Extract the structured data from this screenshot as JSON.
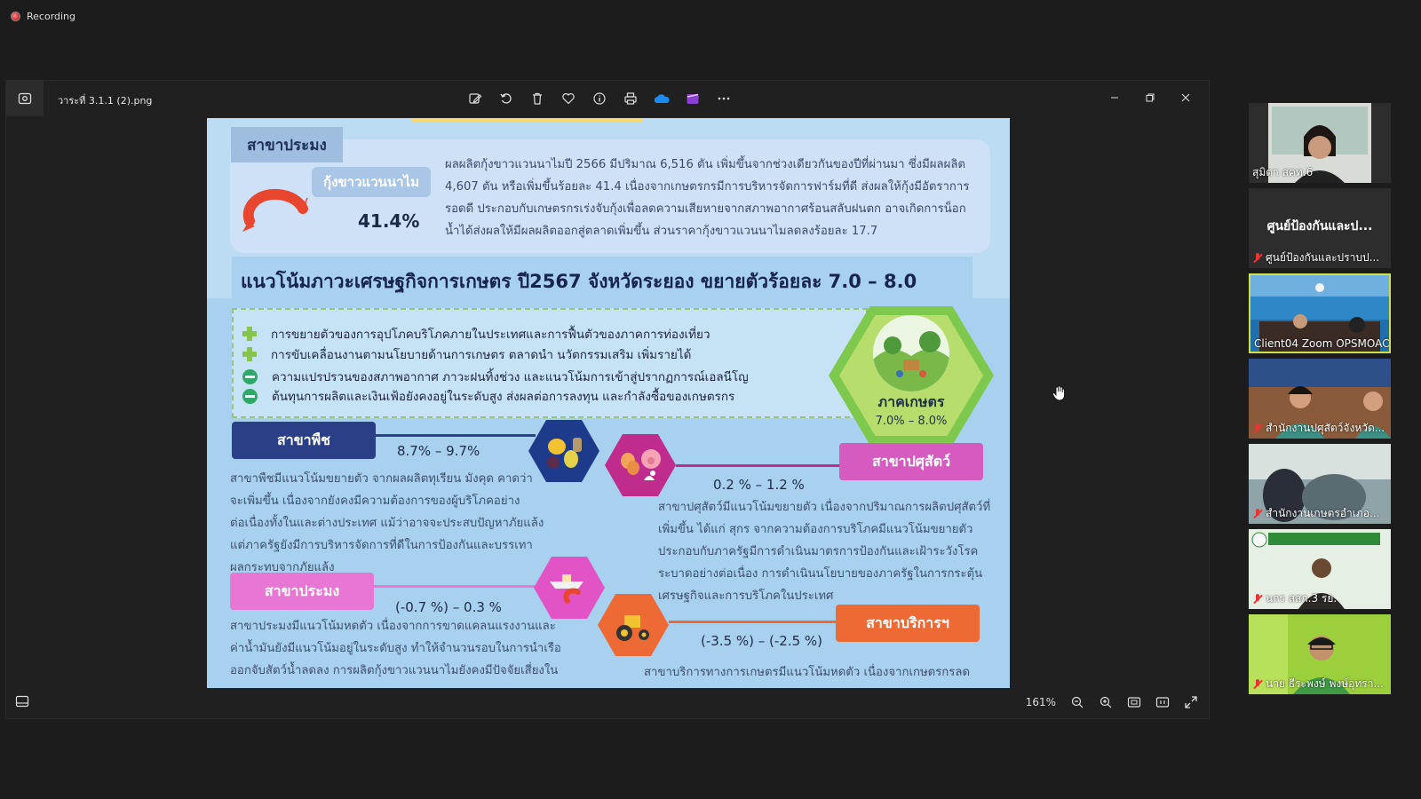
{
  "recording": {
    "label": "Recording"
  },
  "viewer": {
    "filename": "วาระที่ 3.1.1 (2).png",
    "zoom": "161%"
  },
  "infographic": {
    "fish_top": {
      "tab": "สาขาประมง",
      "chip": "กุ้งขาวแวนนาไม",
      "percent": "41.4%",
      "lines": [
        "ผลผลิตกุ้งขาวแวนนาไมปี 2566 มีปริมาณ 6,516 ตัน เพิ่มขึ้นจากช่วงเดียวกันของปีที่ผ่านมา ซึ่งมีผลผลิต",
        "4,607 ตัน หรือเพิ่มขึ้นร้อยละ 41.4 เนื่องจากเกษตรกรมีการบริหารจัดการฟาร์มที่ดี ส่งผลให้กุ้งมีอัตราการ",
        "รอดดี ประกอบกับเกษตรกรเร่งจับกุ้งเพื่อลดความเสียหายจากสภาพอากาศร้อนสลับฝนตก อาจเกิดการน็อก",
        "น้ำได้ส่งผลให้มีผลผลิตออกสู่ตลาดเพิ่มขึ้น ส่วนราคากุ้งขาวแวนนาไมลดลงร้อยละ 17.7"
      ]
    },
    "headline": "แนวโน้มภาวะเศรษฐกิจการเกษตร ปี2567 จังหวัดระยอง ขยายตัวร้อยละ 7.0 – 8.0",
    "factors": [
      "การขยายตัวของการอุปโภคบริโภคภายในประเทศและการฟื้นตัวของภาคการท่องเที่ยว",
      "การขับเคลื่อนงานตามนโยบายด้านการเกษตร ตลาดนำ นวัตกรรมเสริม เพิ่มรายได้",
      "ความแปรปรวนของสภาพอากาศ ภาวะฝนทิ้งช่วง และแนวโน้มการเข้าสู่ปรากฏการณ์เอลนีโญ",
      "ต้นทุนการผลิตและเงินเฟ้อยังคงอยู่ในระดับสูง ส่งผลต่อการลงทุน และกำลังซื้อของเกษตรกร"
    ],
    "agri": {
      "label": "ภาคเกษตร",
      "range": "7.0% – 8.0%"
    },
    "plant": {
      "tab": "สาขาพืช",
      "range": "8.7% – 9.7%",
      "lines": [
        "สาขาพืชมีแนวโน้มขยายตัว จากผลผลิตทุเรียน มังคุด คาดว่า",
        "จะเพิ่มขึ้น เนื่องจากยังคงมีความต้องการของผู้บริโภคอย่าง",
        "ต่อเนื่องทั้งในและต่างประเทศ แม้ว่าอาจจะประสบปัญหาภัยแล้ง",
        "แต่ภาครัฐยังมีการบริหารจัดการที่ดีในการป้องกันและบรรเทา",
        "ผลกระทบจากภัยแล้ง"
      ]
    },
    "livestock": {
      "tab": "สาขาปศุสัตว์",
      "range": "0.2 % – 1.2 %",
      "lines": [
        "สาขาปศุสัตว์มีแนวโน้มขยายตัว เนื่องจากปริมาณการผลิตปศุสัตว์ที่",
        "เพิ่มขึ้น ได้แก่ สุกร จากความต้องการบริโภคมีแนวโน้มขยายตัว",
        "ประกอบกับภาครัฐมีการดำเนินมาตรการป้องกันและเฝ้าระวังโรค",
        "ระบาดอย่างต่อเนื่อง การดำเนินนโยบายของภาครัฐในการกระตุ้น",
        "เศรษฐกิจและการบริโภคในประเทศ"
      ]
    },
    "fishery": {
      "tab": "สาขาประมง",
      "range": "(-0.7 %) – 0.3 %",
      "lines": [
        "สาขาประมงมีแนวโน้มหดตัว เนื่องจากการขาดแคลนแรงงานและ",
        "ค่าน้ำมันยังมีแนวโน้มอยู่ในระดับสูง ทำให้จำนวนรอบในการนำเรือ",
        "ออกจับสัตว์น้ำลดลง การผลิตกุ้งขาวแวนนาไมยังคงมีปัจจัยเสี่ยงใน"
      ]
    },
    "services": {
      "tab": "สาขาบริการฯ",
      "range": "(-3.5 %) – (-2.5 %)",
      "lines": [
        "สาขาบริการทางการเกษตรมีแนวโน้มหดตัว เนื่องจากเกษตรกรลด"
      ]
    }
  },
  "participants": [
    {
      "name": "สุมิตา สคท.6"
    },
    {
      "big": "ศูนย์ป้องกันและป...",
      "name": "ศูนย์ป้องกันและปราบป..."
    },
    {
      "name": "Client04 Zoom OPSMOAC"
    },
    {
      "name": "สำนักงานปศุสัตว์จังหวัด..."
    },
    {
      "name": "สำนักงานเกษตรอำเภอ..."
    },
    {
      "name": "นกร สสก.3 รย."
    },
    {
      "name": "นาย ธีระพงษ์ พงษ์อุทรา..."
    }
  ],
  "colors": {
    "accent_plant": "#2a3f86",
    "accent_livestock": "#d65bc0",
    "accent_fishery": "#e877d4",
    "accent_services": "#ee6a35",
    "active_speaker": "#cfe04a"
  }
}
